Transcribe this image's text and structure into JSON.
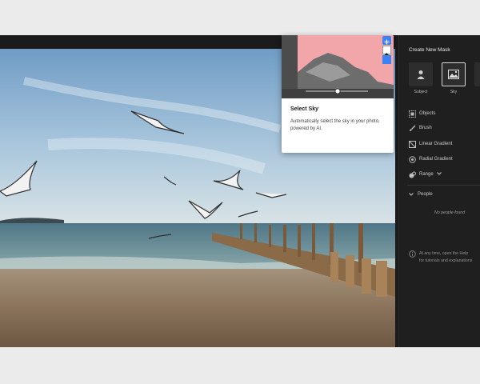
{
  "popover": {
    "title": "Select Sky",
    "description": "Automatically select the sky in your photo, powered by AI."
  },
  "panel": {
    "title": "Create New Mask",
    "mask_types": [
      {
        "label": "Subject",
        "icon": "person-icon"
      },
      {
        "label": "Sky",
        "icon": "sky-icon"
      }
    ],
    "tools": [
      {
        "label": "Objects",
        "icon": "objects-icon"
      },
      {
        "label": "Brush",
        "icon": "brush-icon"
      },
      {
        "label": "Linear Gradient",
        "icon": "linear-gradient-icon"
      },
      {
        "label": "Radial Gradient",
        "icon": "radial-gradient-icon"
      },
      {
        "label": "Range",
        "icon": "range-icon"
      }
    ],
    "people_label": "People",
    "no_people_text": "No people found",
    "info_lines": [
      "At any time, open the Help",
      "for tutorials and explanations"
    ]
  },
  "colors": {
    "accent_blue": "#3b82f6",
    "sky_overlay": "#f3a6aa",
    "panel_bg": "#1f1f1f"
  }
}
